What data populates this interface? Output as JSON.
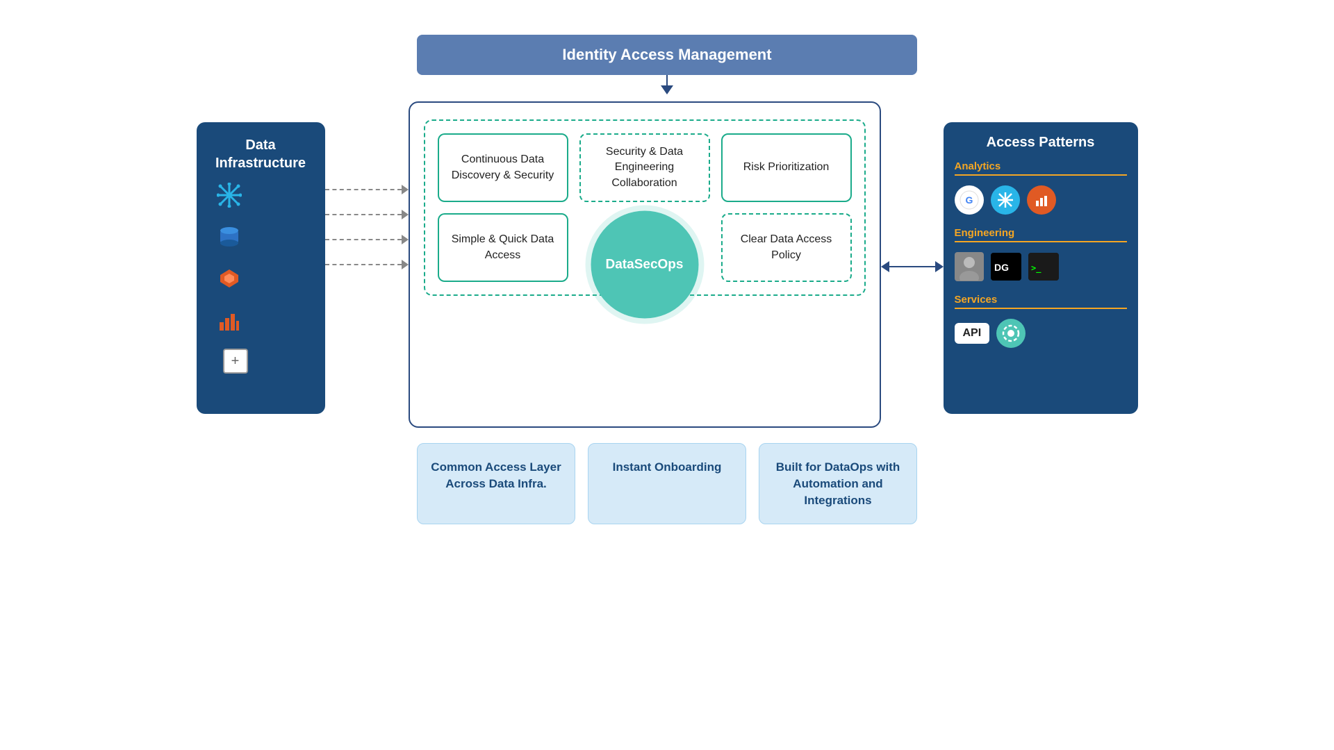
{
  "iam": {
    "title": "Identity Access Management"
  },
  "data_infra": {
    "title": "Data Infrastructure",
    "icons": [
      {
        "name": "snowflake",
        "symbol": "❄",
        "color": "#29b5e8"
      },
      {
        "name": "redshift",
        "symbol": "🟦",
        "color": "#2d72c5"
      },
      {
        "name": "databricks",
        "symbol": "⬟",
        "color": "#e05a24"
      },
      {
        "name": "analytics",
        "symbol": "📊",
        "color": "#e05a24"
      }
    ],
    "plus_label": "+"
  },
  "center_boxes": {
    "continuous": "Continuous Data Discovery & Security",
    "security": "Security & Data Engineering Collaboration",
    "risk": "Risk Prioritization",
    "simple": "Simple & Quick Data Access",
    "datasecops": "DataSecOps",
    "clear": "Clear Data Access Policy"
  },
  "access_patterns": {
    "title": "Access Patterns",
    "sections": [
      {
        "label": "Analytics",
        "icons": [
          "google-icon",
          "snowflake-icon",
          "chart-icon"
        ]
      },
      {
        "label": "Engineering",
        "icons": [
          "person-icon",
          "datagrip-icon",
          "terminal-icon"
        ]
      },
      {
        "label": "Services",
        "icons": [
          "api-label",
          "gear-icon"
        ]
      }
    ],
    "analytics_label": "Analytics",
    "engineering_label": "Engineering",
    "services_label": "Services",
    "api_label": "API"
  },
  "bottom_cards": [
    {
      "text": "Common Access Layer Across Data Infra."
    },
    {
      "text": "Instant Onboarding"
    },
    {
      "text": "Built for DataOps with Automation and Integrations"
    }
  ]
}
